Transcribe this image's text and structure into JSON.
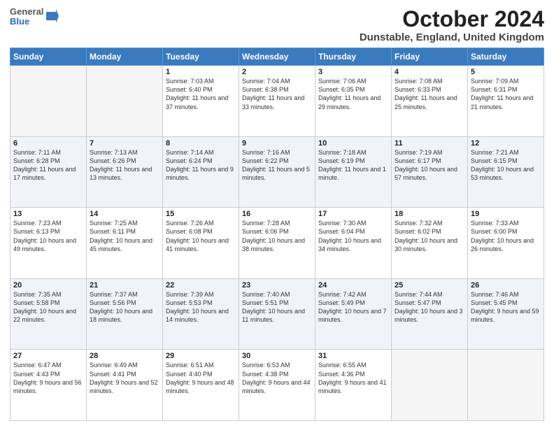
{
  "header": {
    "logo": {
      "line1": "General",
      "line2": "Blue"
    },
    "title": "October 2024",
    "subtitle": "Dunstable, England, United Kingdom"
  },
  "days_of_week": [
    "Sunday",
    "Monday",
    "Tuesday",
    "Wednesday",
    "Thursday",
    "Friday",
    "Saturday"
  ],
  "weeks": [
    [
      {
        "num": "",
        "detail": ""
      },
      {
        "num": "",
        "detail": ""
      },
      {
        "num": "1",
        "detail": "Sunrise: 7:03 AM\nSunset: 6:40 PM\nDaylight: 11 hours and 37 minutes."
      },
      {
        "num": "2",
        "detail": "Sunrise: 7:04 AM\nSunset: 6:38 PM\nDaylight: 11 hours and 33 minutes."
      },
      {
        "num": "3",
        "detail": "Sunrise: 7:06 AM\nSunset: 6:35 PM\nDaylight: 11 hours and 29 minutes."
      },
      {
        "num": "4",
        "detail": "Sunrise: 7:08 AM\nSunset: 6:33 PM\nDaylight: 11 hours and 25 minutes."
      },
      {
        "num": "5",
        "detail": "Sunrise: 7:09 AM\nSunset: 6:31 PM\nDaylight: 11 hours and 21 minutes."
      }
    ],
    [
      {
        "num": "6",
        "detail": "Sunrise: 7:11 AM\nSunset: 6:28 PM\nDaylight: 11 hours and 17 minutes."
      },
      {
        "num": "7",
        "detail": "Sunrise: 7:13 AM\nSunset: 6:26 PM\nDaylight: 11 hours and 13 minutes."
      },
      {
        "num": "8",
        "detail": "Sunrise: 7:14 AM\nSunset: 6:24 PM\nDaylight: 11 hours and 9 minutes."
      },
      {
        "num": "9",
        "detail": "Sunrise: 7:16 AM\nSunset: 6:22 PM\nDaylight: 11 hours and 5 minutes."
      },
      {
        "num": "10",
        "detail": "Sunrise: 7:18 AM\nSunset: 6:19 PM\nDaylight: 11 hours and 1 minute."
      },
      {
        "num": "11",
        "detail": "Sunrise: 7:19 AM\nSunset: 6:17 PM\nDaylight: 10 hours and 57 minutes."
      },
      {
        "num": "12",
        "detail": "Sunrise: 7:21 AM\nSunset: 6:15 PM\nDaylight: 10 hours and 53 minutes."
      }
    ],
    [
      {
        "num": "13",
        "detail": "Sunrise: 7:23 AM\nSunset: 6:13 PM\nDaylight: 10 hours and 49 minutes."
      },
      {
        "num": "14",
        "detail": "Sunrise: 7:25 AM\nSunset: 6:11 PM\nDaylight: 10 hours and 45 minutes."
      },
      {
        "num": "15",
        "detail": "Sunrise: 7:26 AM\nSunset: 6:08 PM\nDaylight: 10 hours and 41 minutes."
      },
      {
        "num": "16",
        "detail": "Sunrise: 7:28 AM\nSunset: 6:06 PM\nDaylight: 10 hours and 38 minutes."
      },
      {
        "num": "17",
        "detail": "Sunrise: 7:30 AM\nSunset: 6:04 PM\nDaylight: 10 hours and 34 minutes."
      },
      {
        "num": "18",
        "detail": "Sunrise: 7:32 AM\nSunset: 6:02 PM\nDaylight: 10 hours and 30 minutes."
      },
      {
        "num": "19",
        "detail": "Sunrise: 7:33 AM\nSunset: 6:00 PM\nDaylight: 10 hours and 26 minutes."
      }
    ],
    [
      {
        "num": "20",
        "detail": "Sunrise: 7:35 AM\nSunset: 5:58 PM\nDaylight: 10 hours and 22 minutes."
      },
      {
        "num": "21",
        "detail": "Sunrise: 7:37 AM\nSunset: 5:56 PM\nDaylight: 10 hours and 18 minutes."
      },
      {
        "num": "22",
        "detail": "Sunrise: 7:39 AM\nSunset: 5:53 PM\nDaylight: 10 hours and 14 minutes."
      },
      {
        "num": "23",
        "detail": "Sunrise: 7:40 AM\nSunset: 5:51 PM\nDaylight: 10 hours and 11 minutes."
      },
      {
        "num": "24",
        "detail": "Sunrise: 7:42 AM\nSunset: 5:49 PM\nDaylight: 10 hours and 7 minutes."
      },
      {
        "num": "25",
        "detail": "Sunrise: 7:44 AM\nSunset: 5:47 PM\nDaylight: 10 hours and 3 minutes."
      },
      {
        "num": "26",
        "detail": "Sunrise: 7:46 AM\nSunset: 5:45 PM\nDaylight: 9 hours and 59 minutes."
      }
    ],
    [
      {
        "num": "27",
        "detail": "Sunrise: 6:47 AM\nSunset: 4:43 PM\nDaylight: 9 hours and 56 minutes."
      },
      {
        "num": "28",
        "detail": "Sunrise: 6:49 AM\nSunset: 4:41 PM\nDaylight: 9 hours and 52 minutes."
      },
      {
        "num": "29",
        "detail": "Sunrise: 6:51 AM\nSunset: 4:40 PM\nDaylight: 9 hours and 48 minutes."
      },
      {
        "num": "30",
        "detail": "Sunrise: 6:53 AM\nSunset: 4:38 PM\nDaylight: 9 hours and 44 minutes."
      },
      {
        "num": "31",
        "detail": "Sunrise: 6:55 AM\nSunset: 4:36 PM\nDaylight: 9 hours and 41 minutes."
      },
      {
        "num": "",
        "detail": ""
      },
      {
        "num": "",
        "detail": ""
      }
    ]
  ]
}
